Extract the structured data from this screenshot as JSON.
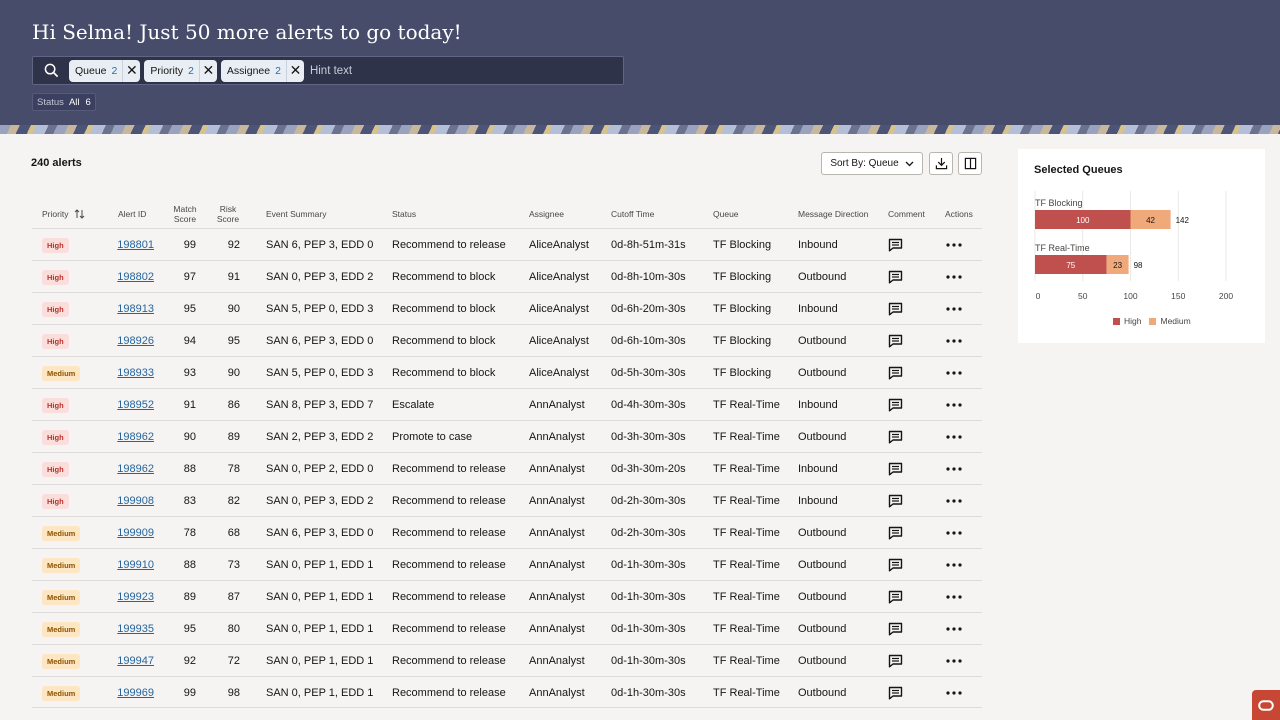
{
  "header": {
    "greeting": "Hi Selma! Just 50 more alerts to go today!",
    "chips": [
      {
        "label": "Queue",
        "count": "2"
      },
      {
        "label": "Priority",
        "count": "2"
      },
      {
        "label": "Assignee",
        "count": "2"
      }
    ],
    "search_placeholder": "Hint text",
    "status_filter": {
      "label": "Status",
      "value": "All",
      "count": "6"
    }
  },
  "toolbar": {
    "alert_count": "240 alerts",
    "sort_label": "Sort By: Queue"
  },
  "table": {
    "columns": {
      "priority": "Priority",
      "alert_id": "Alert ID",
      "match_score": "Match Score",
      "risk_score": "Risk Score",
      "event_summary": "Event Summary",
      "status": "Status",
      "assignee": "Assignee",
      "cutoff_time": "Cutoff Time",
      "queue": "Queue",
      "message_direction": "Message Direction",
      "comment": "Comment",
      "actions": "Actions"
    },
    "rows": [
      {
        "priority": "High",
        "id": "198801",
        "match": "99",
        "risk": "92",
        "summary": "SAN 6, PEP 3, EDD 0",
        "status": "Recommend to release",
        "assignee": "AliceAnalyst",
        "cutoff": "0d-8h-51m-31s",
        "queue": "TF Blocking",
        "direction": "Inbound"
      },
      {
        "priority": "High",
        "id": "198802",
        "match": "97",
        "risk": "91",
        "summary": "SAN 0, PEP 3, EDD 2",
        "status": "Recommend to block",
        "assignee": "AliceAnalyst",
        "cutoff": "0d-8h-10m-30s",
        "queue": "TF Blocking",
        "direction": "Outbound"
      },
      {
        "priority": "High",
        "id": "198913",
        "match": "95",
        "risk": "90",
        "summary": "SAN 5, PEP 0, EDD 3",
        "status": "Recommend to block",
        "assignee": "AliceAnalyst",
        "cutoff": "0d-6h-20m-30s",
        "queue": "TF Blocking",
        "direction": "Inbound"
      },
      {
        "priority": "High",
        "id": "198926",
        "match": "94",
        "risk": "95",
        "summary": "SAN 6, PEP 3, EDD 0",
        "status": "Recommend to block",
        "assignee": "AliceAnalyst",
        "cutoff": "0d-6h-10m-30s",
        "queue": "TF Blocking",
        "direction": "Outbound"
      },
      {
        "priority": "Medium",
        "id": "198933",
        "match": "93",
        "risk": "90",
        "summary": "SAN 5, PEP 0, EDD 3",
        "status": "Recommend to block",
        "assignee": "AliceAnalyst",
        "cutoff": "0d-5h-30m-30s",
        "queue": "TF Blocking",
        "direction": "Outbound"
      },
      {
        "priority": "High",
        "id": "198952",
        "match": "91",
        "risk": "86",
        "summary": "SAN 8, PEP 3, EDD 7",
        "status": "Escalate",
        "assignee": "AnnAnalyst",
        "cutoff": "0d-4h-30m-30s",
        "queue": "TF Real-Time",
        "direction": "Inbound"
      },
      {
        "priority": "High",
        "id": "198962",
        "match": "90",
        "risk": "89",
        "summary": "SAN 2, PEP 3, EDD 2",
        "status": "Promote to case",
        "assignee": "AnnAnalyst",
        "cutoff": "0d-3h-30m-30s",
        "queue": "TF Real-Time",
        "direction": "Outbound"
      },
      {
        "priority": "High",
        "id": "198962",
        "match": "88",
        "risk": "78",
        "summary": "SAN 0, PEP 2, EDD 0",
        "status": "Recommend to release",
        "assignee": "AnnAnalyst",
        "cutoff": "0d-3h-30m-20s",
        "queue": "TF Real-Time",
        "direction": "Inbound"
      },
      {
        "priority": "High",
        "id": "199908",
        "match": "83",
        "risk": "82",
        "summary": "SAN 0, PEP 3, EDD 2",
        "status": "Recommend to release",
        "assignee": "AnnAnalyst",
        "cutoff": "0d-2h-30m-30s",
        "queue": "TF Real-Time",
        "direction": "Inbound"
      },
      {
        "priority": "Medium",
        "id": "199909",
        "match": "78",
        "risk": "68",
        "summary": "SAN 6, PEP 3, EDD 0",
        "status": "Recommend to release",
        "assignee": "AnnAnalyst",
        "cutoff": "0d-2h-30m-30s",
        "queue": "TF Real-Time",
        "direction": "Outbound"
      },
      {
        "priority": "Medium",
        "id": "199910",
        "match": "88",
        "risk": "73",
        "summary": "SAN 0, PEP 1, EDD 1",
        "status": "Recommend to release",
        "assignee": "AnnAnalyst",
        "cutoff": "0d-1h-30m-30s",
        "queue": "TF Real-Time",
        "direction": "Outbound"
      },
      {
        "priority": "Medium",
        "id": "199923",
        "match": "89",
        "risk": "87",
        "summary": "SAN 0, PEP 1, EDD 1",
        "status": "Recommend to release",
        "assignee": "AnnAnalyst",
        "cutoff": "0d-1h-30m-30s",
        "queue": "TF Real-Time",
        "direction": "Outbound"
      },
      {
        "priority": "Medium",
        "id": "199935",
        "match": "95",
        "risk": "80",
        "summary": "SAN 0, PEP 1, EDD 1",
        "status": "Recommend to release",
        "assignee": "AnnAnalyst",
        "cutoff": "0d-1h-30m-30s",
        "queue": "TF Real-Time",
        "direction": "Outbound"
      },
      {
        "priority": "Medium",
        "id": "199947",
        "match": "92",
        "risk": "72",
        "summary": "SAN 0, PEP 1, EDD 1",
        "status": "Recommend to release",
        "assignee": "AnnAnalyst",
        "cutoff": "0d-1h-30m-30s",
        "queue": "TF Real-Time",
        "direction": "Outbound"
      },
      {
        "priority": "Medium",
        "id": "199969",
        "match": "99",
        "risk": "98",
        "summary": "SAN 0, PEP 1, EDD 1",
        "status": "Recommend to release",
        "assignee": "AnnAnalyst",
        "cutoff": "0d-1h-30m-30s",
        "queue": "TF Real-Time",
        "direction": "Outbound"
      }
    ]
  },
  "panel": {
    "title": "Selected Queues"
  },
  "chart_data": {
    "type": "bar",
    "orientation": "horizontal",
    "stacked": true,
    "categories": [
      "TF Blocking",
      "TF Real-Time"
    ],
    "series": [
      {
        "name": "High",
        "values": [
          100,
          75
        ],
        "color": "#c0504d"
      },
      {
        "name": "Medium",
        "values": [
          42,
          23
        ],
        "color": "#f0a97a"
      }
    ],
    "totals": [
      142,
      98
    ],
    "xlim": [
      0,
      200
    ],
    "xticks": [
      0,
      50,
      100,
      150,
      200
    ],
    "grid": true,
    "legend_position": "bottom"
  },
  "colors": {
    "header_bg": "#464c6a",
    "badge_high_bg": "#fbdedb",
    "badge_medium_bg": "#fde6c1",
    "link": "#27659c",
    "brand": "#c74634"
  }
}
